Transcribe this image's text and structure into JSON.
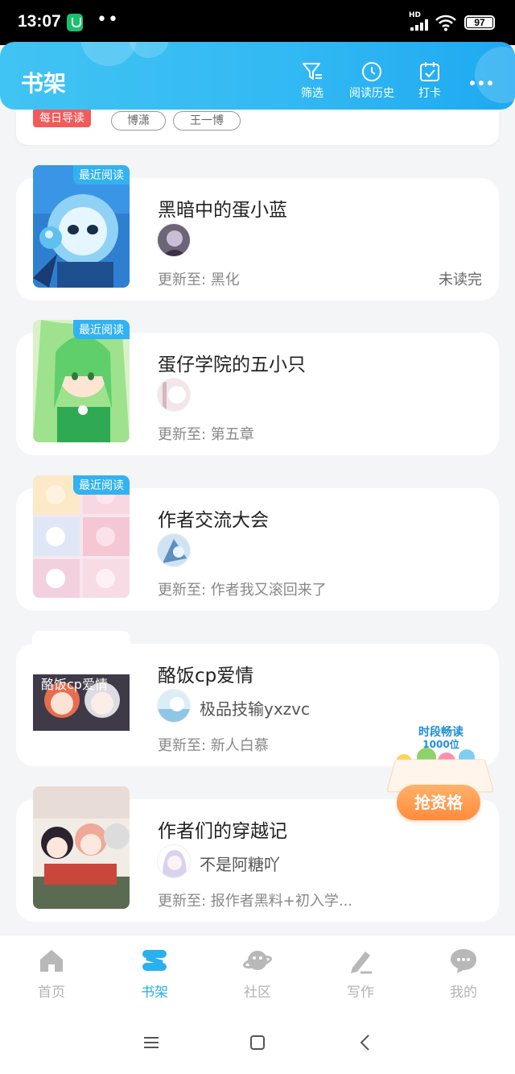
{
  "status_bar": {
    "time": "13:07",
    "dots": "••",
    "network": "HD",
    "battery": "97"
  },
  "header": {
    "title": "书架",
    "filter_label": "筛选",
    "history_label": "阅读历史",
    "checkin_label": "打卡"
  },
  "daily": {
    "badge": "每日导读",
    "tags": [
      "博潇",
      "王一博"
    ]
  },
  "books": [
    {
      "badge": "最近阅读",
      "title": "黑暗中的蛋小蓝",
      "author": "",
      "update": "更新至: 黑化",
      "status": "未读完"
    },
    {
      "badge": "最近阅读",
      "title": "蛋仔学院的五小只",
      "author": "",
      "update": "更新至: 第五章",
      "status": ""
    },
    {
      "badge": "最近阅读",
      "title": "作者交流大会",
      "author": "",
      "update": "更新至: 作者我又滚回来了",
      "status": ""
    },
    {
      "badge": "",
      "title": "酪饭cp爱情",
      "author": "极品技输yxzvc",
      "update": "更新至: 新人白慕",
      "status": ""
    },
    {
      "badge": "",
      "title": "作者们的穿越记",
      "author": "不是阿糖吖",
      "update": "更新至: 报作者黑料+初入学...",
      "status": ""
    }
  ],
  "promo": {
    "line1": "时段畅读",
    "line2": "1000位",
    "button": "抢资格"
  },
  "nav": {
    "home": "首页",
    "bookshelf": "书架",
    "community": "社区",
    "write": "写作",
    "mine": "我的",
    "active_color": "#2ab0f0"
  }
}
